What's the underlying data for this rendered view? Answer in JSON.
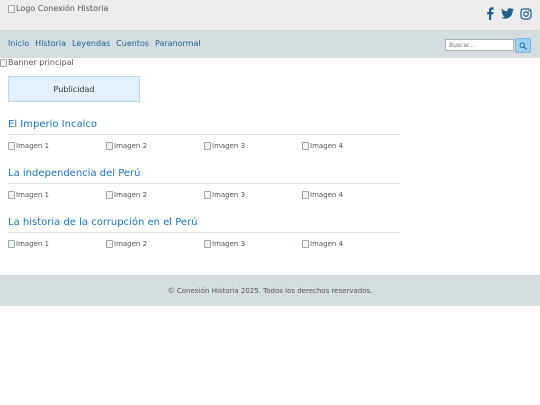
{
  "header": {
    "logo_alt": "Logo Conexión Historia",
    "social": [
      "facebook-icon",
      "twitter-icon",
      "instagram-icon"
    ]
  },
  "nav": {
    "items": [
      "Inicio",
      "Historia",
      "Leyendas",
      "Cuentos",
      "Paranormal"
    ],
    "search_placeholder": "Buscar..."
  },
  "banner_alt": "Banner principal",
  "ad_label": "Publicidad",
  "sections": [
    {
      "title": "El Imperio Incaico",
      "images": [
        "Imagen 1",
        "Imagen 2",
        "Imagen 3",
        "Imagen 4"
      ]
    },
    {
      "title": "La independencia del Perú",
      "images": [
        "Imagen 1",
        "Imagen 2",
        "Imagen 3",
        "Imagen 4"
      ]
    },
    {
      "title": "La historia de la corrupción en el Perú",
      "images": [
        "Imagen 1",
        "Imagen 2",
        "Imagen 3",
        "Imagen 4"
      ]
    }
  ],
  "footer_text": "© Conexión Historia 2025. Todos los derechos reservados.",
  "colors": {
    "accent": "#1b75b8",
    "nav_bg": "#d5dde1",
    "header_bg": "#ececec",
    "ad_bg": "#e2f0fb"
  }
}
